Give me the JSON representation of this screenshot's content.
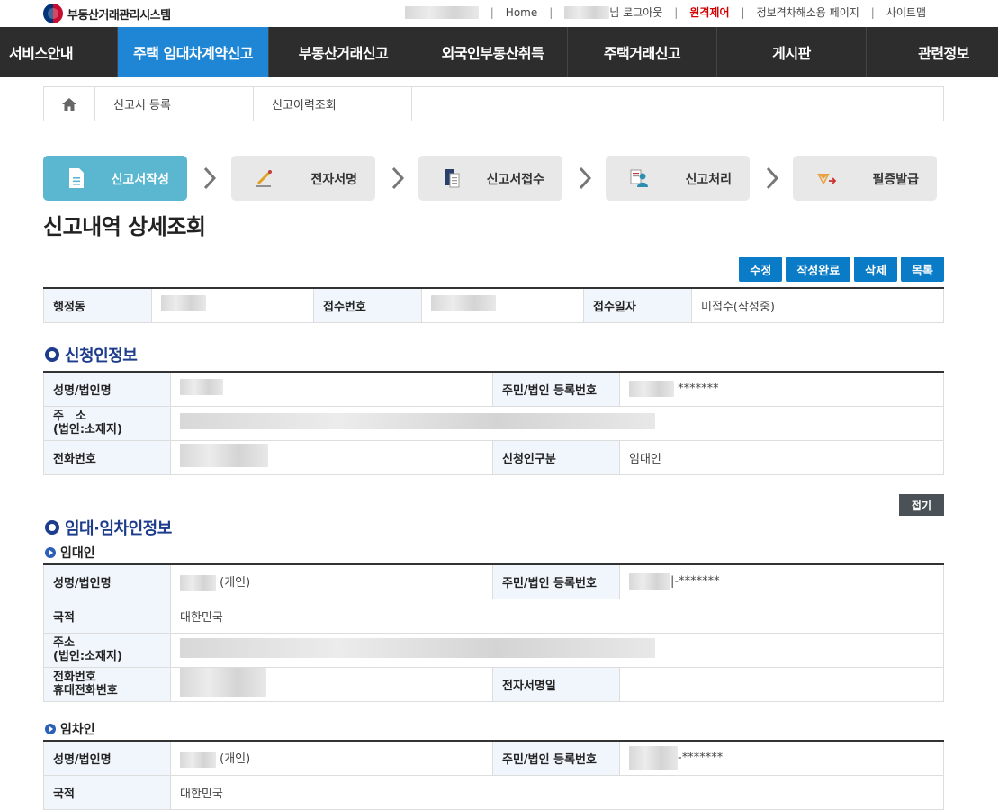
{
  "header": {
    "logo_text": "부동산거래관리시스템",
    "util": {
      "home": "Home",
      "logout": "님 로그아웃",
      "remote": "원격제어",
      "accessibility": "정보격차해소용 페이지",
      "sitemap": "사이트맵"
    }
  },
  "gnb": {
    "items": [
      {
        "label": "서비스안내"
      },
      {
        "label": "주택 임대차계약신고"
      },
      {
        "label": "부동산거래신고"
      },
      {
        "label": "외국인부동산취득"
      },
      {
        "label": "주택거래신고"
      },
      {
        "label": "게시판"
      },
      {
        "label": "관련정보"
      }
    ]
  },
  "breadcrumb": {
    "items": [
      {
        "label": "신고서 등록"
      },
      {
        "label": "신고이력조회"
      }
    ]
  },
  "steps": [
    {
      "label": "신고서작성",
      "icon": "document-icon"
    },
    {
      "label": "전자서명",
      "icon": "pen-icon"
    },
    {
      "label": "신고서접수",
      "icon": "file-stack-icon"
    },
    {
      "label": "신고처리",
      "icon": "person-document-icon"
    },
    {
      "label": "필증발급",
      "icon": "certificate-icon"
    }
  ],
  "page_title": "신고내역 상세조회",
  "actions": {
    "edit": "수정",
    "complete": "작성완료",
    "delete": "삭제",
    "list": "목록"
  },
  "summary": {
    "dong_label": "행정동",
    "receipt_no_label": "접수번호",
    "receipt_date_label": "접수일자",
    "receipt_date_value": "미접수(작성중)"
  },
  "applicant": {
    "title": "신청인정보",
    "name_label": "성명/법인명",
    "reg_no_label": "주민/법인 등록번호",
    "reg_no_masked": "*******",
    "address_label_1": "주　소",
    "address_label_2": "(법인:소재지)",
    "phone_label": "전화번호",
    "type_label": "신청인구분",
    "type_value": "임대인"
  },
  "fold_button": "접기",
  "lease": {
    "title": "임대·임차인정보",
    "lessor": {
      "subtitle": "임대인",
      "name_label": "성명/법인명",
      "name_suffix": "(개인)",
      "reg_no_label": "주민/법인 등록번호",
      "reg_no_masked": "-*******",
      "nationality_label": "국적",
      "nationality_value": "대한민국",
      "address_label_1": "주소",
      "address_label_2": "(법인:소재지)",
      "phone_label_1": "전화번호",
      "phone_label_2": "휴대전화번호",
      "esign_label": "전자서명일"
    },
    "lessee": {
      "subtitle": "임차인",
      "name_label": "성명/법인명",
      "name_suffix": "(개인)",
      "reg_no_label": "주민/법인 등록번호",
      "reg_no_masked": "-*******",
      "nationality_label": "국적",
      "nationality_value": "대한민국"
    }
  },
  "colors": {
    "gnb_bg": "#2d2d2d",
    "gnb_active": "#1e86d4",
    "step_active": "#5bb7cf",
    "button_blue": "#0a7cc7",
    "section_title": "#1d3d8c",
    "header_cell": "#f0f6fc"
  }
}
